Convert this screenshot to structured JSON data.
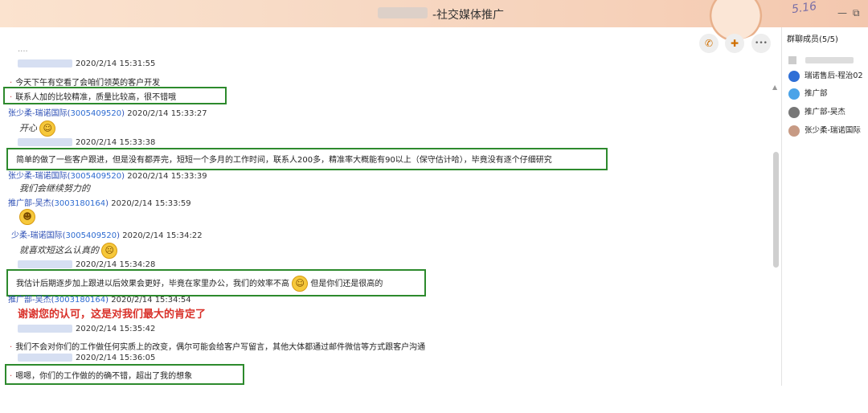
{
  "window": {
    "title": "-社交媒体推广",
    "decor_text": "5.16",
    "minimize": "—",
    "restore": "⧉"
  },
  "actions": {
    "phone": "✆",
    "share": "✚",
    "more": "•••"
  },
  "chat": {
    "ellipsis": "....",
    "ts1": "2020/2/14 15:31:55",
    "m1": "今天下午有空看了会咱们领英的客户开发",
    "m2": "联系人加的比较精准，质量比较高，很不错哦",
    "s3": "张少柔-瑞诺国际(",
    "s3_qq": "3005409520",
    "s3_close": ")",
    "ts3": "2020/2/14 15:33:27",
    "m3": "开心",
    "ts4": "2020/2/14 15:33:38",
    "m4": "简单的做了一些客户跟进，但是没有都弄完，短短一个多月的工作时间，联系人200多，精准率大概能有90以上（保守估计哈），毕竟没有逐个仔细研究",
    "s5": "张少柔-瑞诺国际(",
    "s5_qq": "3005409520",
    "s5_close": ")",
    "ts5": "2020/2/14 15:33:39",
    "m5": "我们会继续努力的",
    "s6": "推广部-吴杰(",
    "s6_qq": "3003180164",
    "s6_close": ")",
    "ts6": "2020/2/14 15:33:59",
    "s7": "少柔-瑞诺国际(",
    "s7_qq": "3005409520",
    "s7_close": ")",
    "ts7": "2020/2/14 15:34:22",
    "m7": "就喜欢短这么认真的",
    "ts8": "2020/2/14 15:34:28",
    "m8a": "我估计后期逐步加上跟进以后效果会更好，毕竟在家里办公，我们的效率不高",
    "m8b": "但是你们还是很高的",
    "s9": "推广部-吴杰(",
    "s9_qq": "3003180164",
    "s9_close": ")",
    "ts9": "2020/2/14 15:34:54",
    "m9": "谢谢您的认可，这是对我们最大的肯定了",
    "ts10": "2020/2/14 15:35:42",
    "m10": "我们不会对你们的工作做任何实质上的改变，偶尔可能会给客户写留言，其他大体都通过邮件微信等方式跟客户沟通",
    "ts11": "2020/2/14 15:36:05",
    "m11": "嗯嗯，你们的工作做的的确不错，超出了我的想象"
  },
  "sidebar": {
    "header": "群聊成员(5/5)",
    "members": [
      "瑞诺售后-程治02",
      "推广部",
      "推广部-吴杰",
      "张少柔-瑞诺国际"
    ]
  },
  "colors": {
    "highlight_box": "#2d8a2d",
    "red_text": "#d9312a",
    "qq_link": "#2d6bd1"
  }
}
